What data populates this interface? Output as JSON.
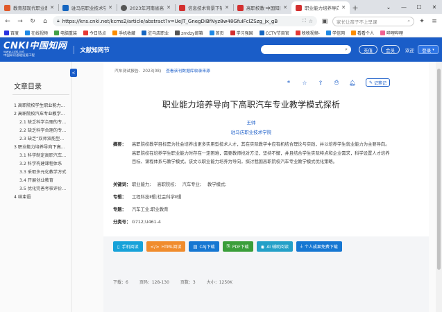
{
  "browser": {
    "tabs": [
      {
        "title": "教育部现代职业教",
        "color": "#e05a2b"
      },
      {
        "title": "驻马店职业技术学",
        "color": "#1565c0"
      },
      {
        "title": "2023年河南省高职",
        "color": "#555555"
      },
      {
        "title": "信息技术背景下铅",
        "color": "#d32f2f"
      },
      {
        "title": "高职校教·中国知网",
        "color": "#d32f2f"
      },
      {
        "title": "职业能力培养导向",
        "color": "#d32f2f",
        "active": true
      }
    ],
    "new_tab": "+",
    "url": "https://kns.cnki.net/kcms2/article/abstract?v=UeJT_GnegDiBfNyz8w48GfuIFclZSzg_jx_gB",
    "search_placeholder": "家长让孩子不上早课",
    "bookmarks": [
      {
        "label": "百度",
        "color": "#2932e1"
      },
      {
        "label": "在线视频",
        "color": "#1e88e5"
      },
      {
        "label": "电脑重装",
        "color": "#43a047"
      },
      {
        "label": "今日热点",
        "color": "#e53935"
      },
      {
        "label": "手机收藏",
        "color": "#fb8c00"
      },
      {
        "label": "驻马店职业",
        "color": "#1565c0"
      },
      {
        "label": "zmdzy邮箱",
        "color": "#555555"
      },
      {
        "label": "首页",
        "color": "#1e88e5"
      },
      {
        "label": "学习强国",
        "color": "#d32f2f"
      },
      {
        "label": "CCTV节目官",
        "color": "#1565c0"
      },
      {
        "label": "秧秧视频-",
        "color": "#e53935"
      },
      {
        "label": "学信网",
        "color": "#1e88e5"
      },
      {
        "label": "看看个人",
        "color": "#fb8c00"
      },
      {
        "label": "哔哩哔哩",
        "color": "#f06292"
      }
    ]
  },
  "header": {
    "logo_main": "CNKI中国知网",
    "logo_sub": "www.cnki.net",
    "logo_cn": "中国知识基础设施工程",
    "section": "文献知网节",
    "recharge": "充值",
    "member": "会员",
    "welcome": "欢迎",
    "login": "登录"
  },
  "sidebar": {
    "title": "文章目录",
    "collapse": "<",
    "items": [
      {
        "text": "1 高职院校学生职业能力...",
        "sub": false
      },
      {
        "text": "2 高职院校汽车专业教学...",
        "sub": false
      },
      {
        "text": "2.1 缺乏科学合理的专...",
        "sub": true
      },
      {
        "text": "2.2 缺乏科学合理的专...",
        "sub": true
      },
      {
        "text": "2.3 缺乏“双师双能型...",
        "sub": true
      },
      {
        "text": "3 职业能力培养导向下高...",
        "sub": false
      },
      {
        "text": "3.1 科学制定高职汽车...",
        "sub": true
      },
      {
        "text": "3.2 科学构建课程体系",
        "sub": true
      },
      {
        "text": "3.3 采取多元化教学方式",
        "sub": true
      },
      {
        "text": "3.4 开展创业教育",
        "sub": true
      },
      {
        "text": "3.5 优化完善考核评价...",
        "sub": true
      },
      {
        "text": "4 结束语",
        "sub": false
      }
    ]
  },
  "article": {
    "source": "汽车测试报告．2023(08)",
    "source_link": "查看该刊数据库收录来源",
    "note_btn": "记笔记",
    "title": "职业能力培养导向下高职汽车专业教学模式探析",
    "author": "王帅",
    "org": "驻马店职业技术学院",
    "abstract_label": "摘要：",
    "abstract": "高职院校教学目标是为社会培养出更多实用型技术人才，其在实际教学中应有机结合理论与实践，并以培养学生就业能力为主要导向。高职院校在培养学生职业能力时存在一定困难，需要教师找对方法，坚持不懈，并且结合学生实际特点和企业需求，科学设置人才培养目标、课程体系与教学模式。该文以职业能力培养为导向，探讨我国高职院校汽车专业教学模式优化策略。",
    "keywords_label": "关键词：",
    "keywords": [
      "职业能力;",
      "高职院校;",
      "汽车专业;",
      "教学模式;"
    ],
    "series_label": "专辑：",
    "series": "工程科技Ⅱ辑;社会科学Ⅱ辑",
    "topic_label": "专题：",
    "topic": "汽车工业;职业教育",
    "class_label": "分类号：",
    "class_no": "G712;U461-4"
  },
  "actions": [
    {
      "label": "手机阅读",
      "icon": "phone-icon",
      "color": "#17a2d9"
    },
    {
      "label": "HTML阅读",
      "icon": "code-icon",
      "color": "#f08c2d"
    },
    {
      "label": "CAJ下载",
      "icon": "book-icon",
      "color": "#1677d2"
    },
    {
      "label": "PDF下载",
      "icon": "pdf-icon",
      "color": "#3a9e3a"
    },
    {
      "label": "AI 辅助阅读",
      "icon": "ai-icon",
      "color": "#24a0c8"
    },
    {
      "label": "个人成果免费下载",
      "icon": "download-icon",
      "color": "#1677d2"
    }
  ],
  "stats": {
    "downloads": "下载：6",
    "pages": "页码：128-130",
    "page_count": "页数：3",
    "size": "大小：1250K"
  }
}
